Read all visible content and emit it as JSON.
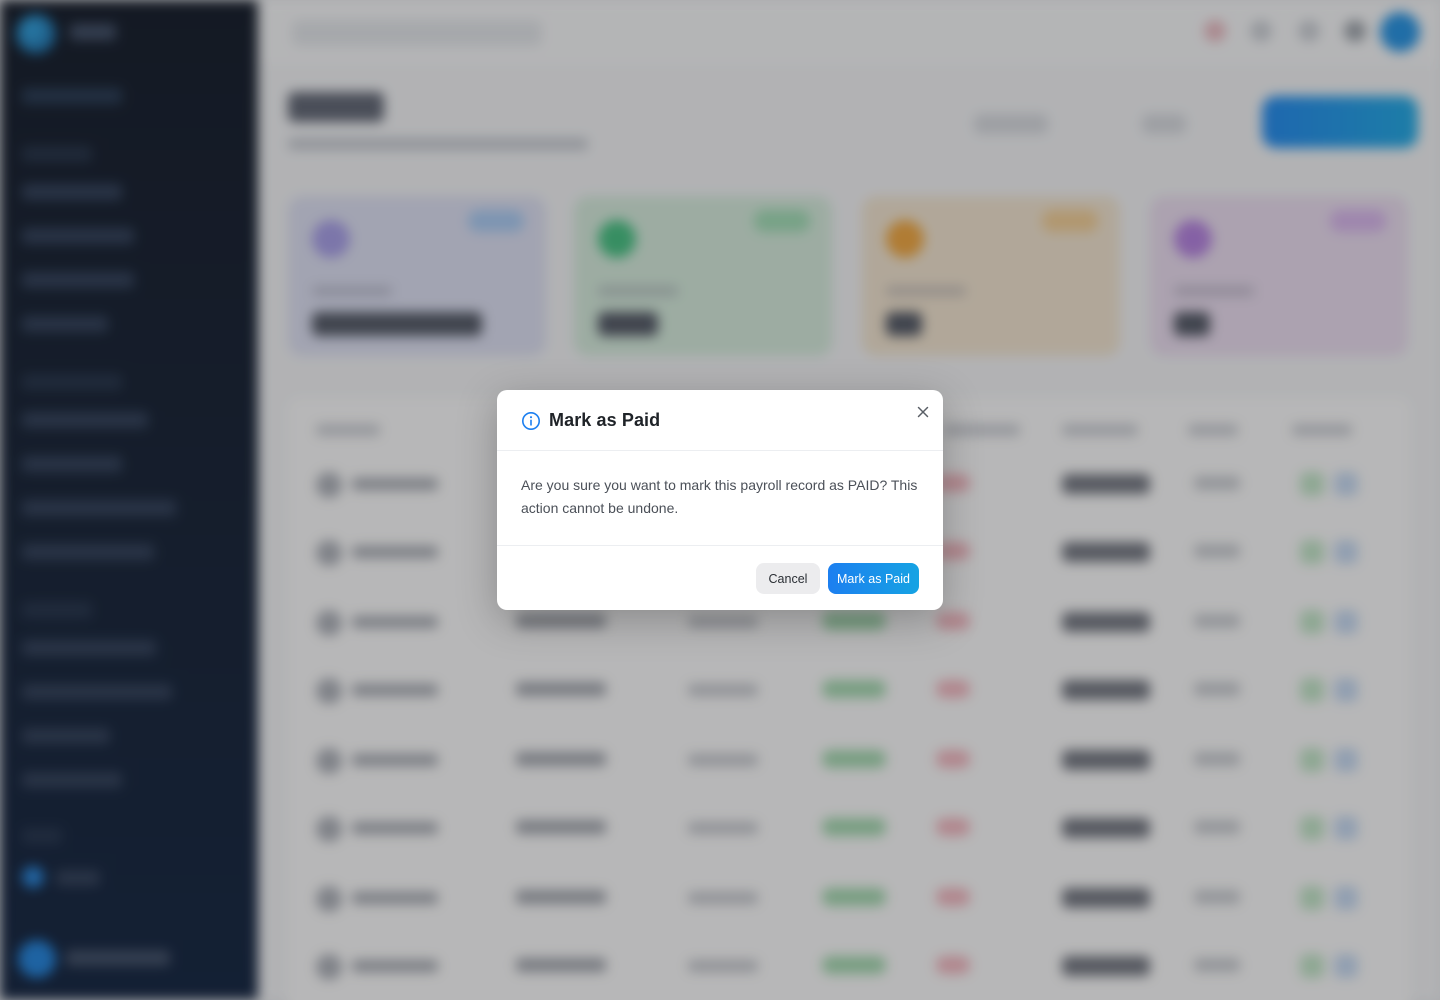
{
  "modal": {
    "title": "Mark as Paid",
    "message": "Are you sure you want to mark this payroll record as PAID? This action cannot be undone.",
    "cancel_label": "Cancel",
    "confirm_label": "Mark as Paid",
    "icons": {
      "title_icon": "info-icon",
      "close_icon": "close-icon"
    }
  },
  "colors": {
    "accent": "#1c7ff0",
    "accent_end": "#16a3e3",
    "sidebar_bg": "#0b1322"
  }
}
